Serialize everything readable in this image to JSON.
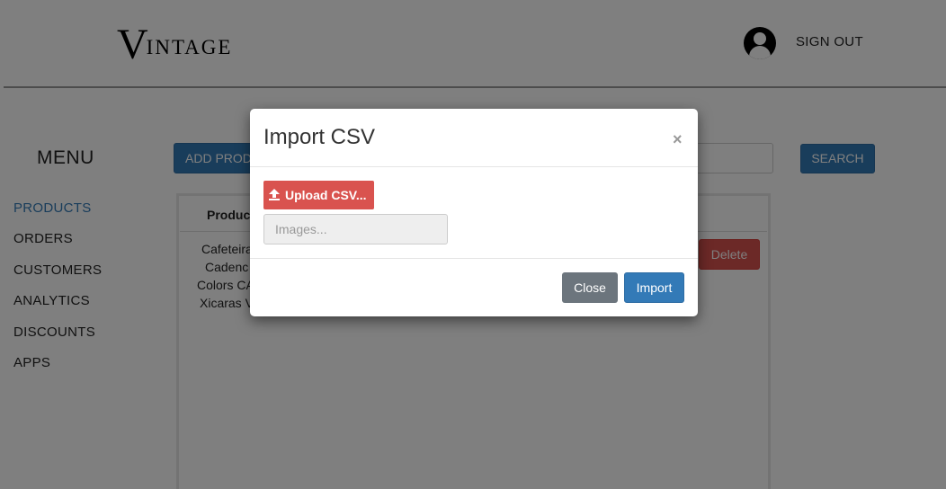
{
  "header": {
    "logo_initial": "V",
    "logo_rest": "INTAGE",
    "signout_label": "SIGN OUT"
  },
  "sidebar": {
    "title": "MENU",
    "items": [
      {
        "label": "PRODUCTS",
        "active": true
      },
      {
        "label": "ORDERS",
        "active": false
      },
      {
        "label": "CUSTOMERS",
        "active": false
      },
      {
        "label": "ANALYTICS",
        "active": false
      },
      {
        "label": "DISCOUNTS",
        "active": false
      },
      {
        "label": "APPS",
        "active": false
      }
    ]
  },
  "toolbar": {
    "add_label": "ADD PROD",
    "search_label": "SEARCH"
  },
  "table": {
    "header_product": "Produc",
    "rows": [
      "Cafeteira",
      "Cadenc",
      "Colors CA",
      "Xicaras V"
    ],
    "delete_label": "Delete"
  },
  "modal": {
    "title": "Import CSV",
    "close_icon": "×",
    "upload_label": "Upload CSV...",
    "images_placeholder": "Images...",
    "close_label": "Close",
    "import_label": "Import"
  },
  "colors": {
    "primary": "#337ab7",
    "danger": "#d9534f",
    "secondary": "#6c757d",
    "backdrop": "rgba(0,0,0,0.5)"
  }
}
